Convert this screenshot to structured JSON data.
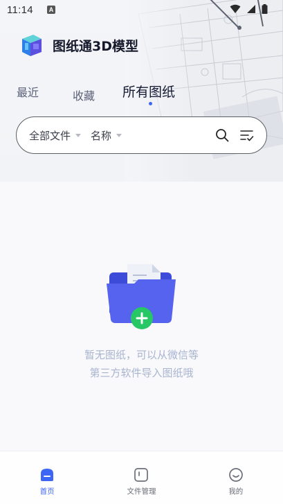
{
  "status_bar": {
    "time": "11:14",
    "notification_badge": "A"
  },
  "app": {
    "title": "图纸通3D模型"
  },
  "tabs": [
    {
      "label": "最近",
      "active": false
    },
    {
      "label": "收藏",
      "active": false
    },
    {
      "label": "所有图纸",
      "active": true
    }
  ],
  "filters": {
    "file_type": "全部文件",
    "sort": "名称"
  },
  "empty_state": {
    "line1": "暂无图纸，可以从微信等",
    "line2": "第三方软件导入图纸哦"
  },
  "bottom_nav": [
    {
      "label": "首页",
      "icon": "home-icon",
      "active": true
    },
    {
      "label": "文件管理",
      "icon": "folder-icon",
      "active": false
    },
    {
      "label": "我的",
      "icon": "smiley-icon",
      "active": false
    }
  ],
  "colors": {
    "accent": "#3e66f4",
    "empty_text": "#a9b4d0",
    "folder": "#4a59e8",
    "plus_badge": "#27c766"
  }
}
